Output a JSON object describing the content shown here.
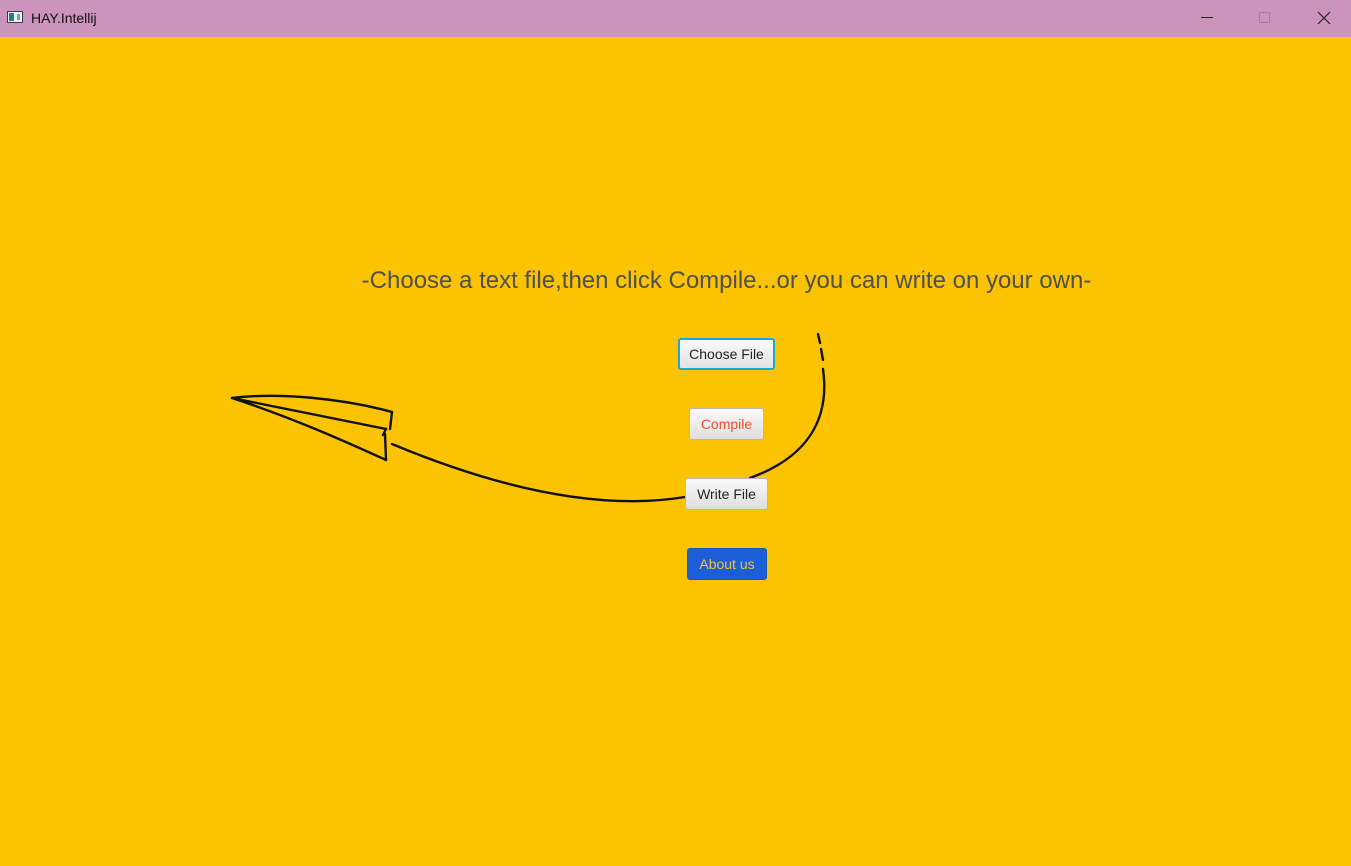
{
  "window": {
    "title": "HAY.Intellij",
    "titlebar_color": "#CC94BC",
    "background_color": "#FCC300",
    "controls": {
      "minimize_icon": "minimize-icon",
      "maximize_icon": "maximize-icon",
      "close_icon": "close-icon"
    }
  },
  "main": {
    "instruction": "-Choose a text file,then click Compile...or you can write on your own-",
    "buttons": {
      "choose_file": "Choose File",
      "compile": "Compile",
      "write_file": "Write File",
      "about_us": "About us"
    },
    "decoration_icon": "paper-plane-icon"
  },
  "colors": {
    "accent_focus": "#1FA6D4",
    "compile_text": "#EE5030",
    "about_bg": "#1C5ED8",
    "about_text": "#F5C23A"
  }
}
